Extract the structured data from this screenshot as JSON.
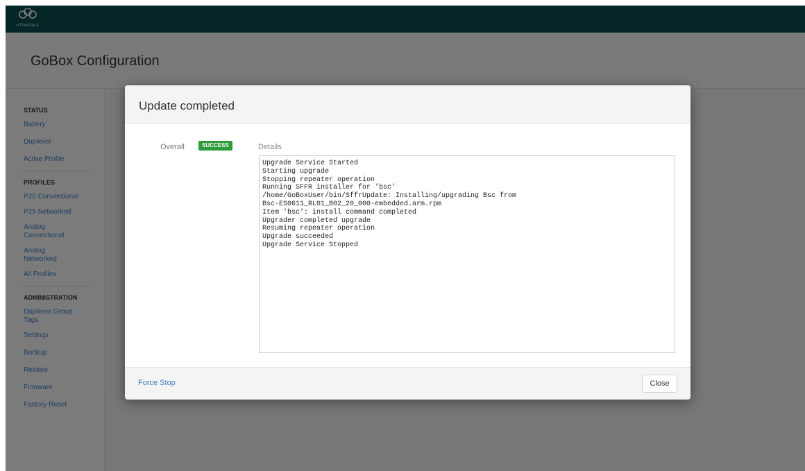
{
  "app": {
    "logo_caption": "eTherstack",
    "page_title": "GoBox Configuration"
  },
  "sidebar": {
    "sections": [
      {
        "title": "STATUS",
        "items": [
          "Battery",
          "Duplexer",
          "Active Profile"
        ]
      },
      {
        "title": "PROFILES",
        "items": [
          "P25 Conventional",
          "P25 Networked",
          "Analog Conventional",
          "Analog Networked",
          "All Profiles"
        ]
      },
      {
        "title": "ADMINISTRATION",
        "items": [
          "Duplexer Group Tags",
          "Settings",
          "Backup",
          "Restore",
          "Firmware",
          "Factory Reset"
        ]
      }
    ]
  },
  "modal": {
    "title": "Update completed",
    "overall_label": "Overall",
    "status_badge": "SUCCESS",
    "details_label": "Details",
    "log_text": "Upgrade Service Started\nStarting upgrade\nStopping repeater operation\nRunning SFFR installer for 'bsc'\n/home/GoBoxUser/bin/SffrUpdate: Installing/upgrading Bsc from\nBsc-ES0611_RL01_B02_20_000-embedded.arm.rpm\nItem 'bsc': install command completed\nUpgrader completed upgrade\nResuming repeater operation\nUpgrade succeeded\nUpgrade Service Stopped",
    "force_stop_label": "Force Stop",
    "close_label": "Close"
  },
  "colors": {
    "topbar": "#0b4a4f",
    "success_badge": "#2e9a3a",
    "link": "#3f7fbf"
  }
}
